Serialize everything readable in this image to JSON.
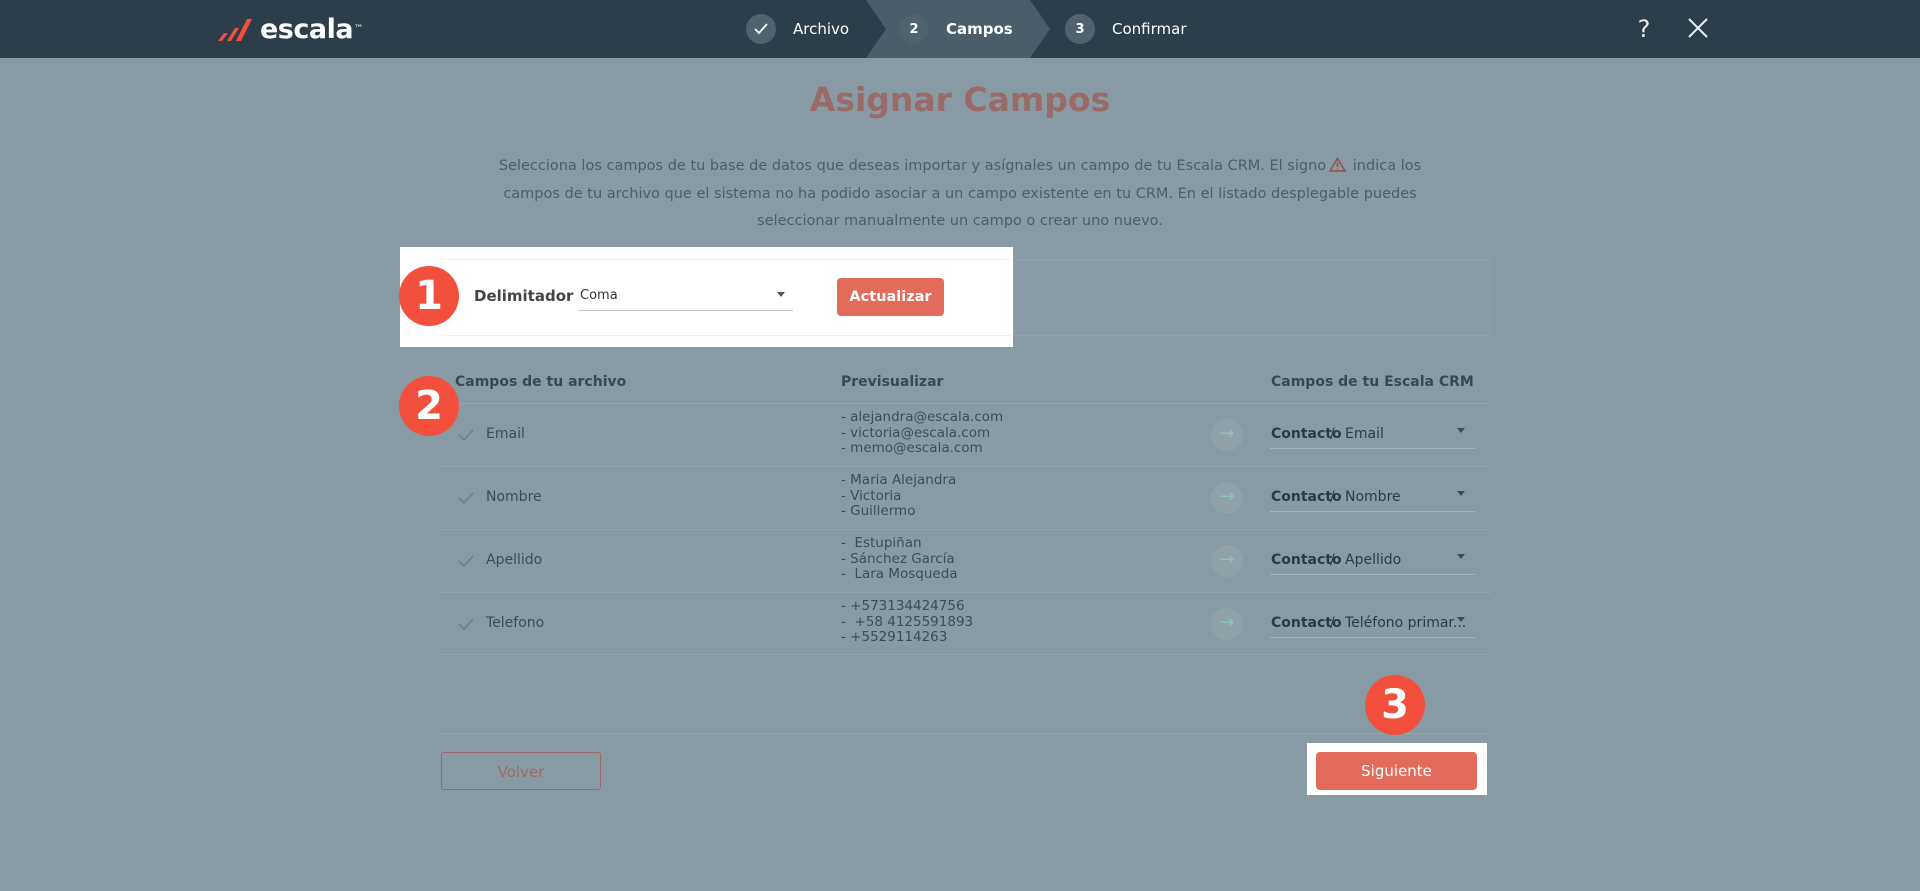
{
  "app": {
    "logo_text": "escala",
    "logo_tm": "™"
  },
  "steps": [
    {
      "number": "",
      "label": "Archivo",
      "state": "done"
    },
    {
      "number": "2",
      "label": "Campos",
      "state": "active"
    },
    {
      "number": "3",
      "label": "Confirmar",
      "state": "pending"
    }
  ],
  "topbar": {
    "help_label": "?",
    "icons": {
      "help": "question-icon",
      "close": "close-icon"
    }
  },
  "page": {
    "title": "Asignar Campos",
    "intro_part1": "Selecciona los campos de tu base de datos que deseas importar y asígnales un campo de tu Escala CRM. El signo",
    "intro_part2": "indica los campos de tu archivo que el sistema no ha podido asociar a un campo existente en tu CRM. En el listado desplegable puedes seleccionar manualmente un campo o crear uno nuevo."
  },
  "delimiter": {
    "label": "Delimitador",
    "value": "Coma",
    "update_label": "Actualizar"
  },
  "markers": [
    "1",
    "2",
    "3"
  ],
  "table": {
    "headers": {
      "file_fields": "Campos de tu archivo",
      "preview": "Previsualizar",
      "crm_fields": "Campos de tu Escala CRM"
    },
    "rows": [
      {
        "field": "Email",
        "preview": [
          "- alejandra@escala.com",
          "- victoria@escala.com",
          "- memo@escala.com"
        ],
        "crm_object": "Contacto",
        "separator": " / ",
        "crm_field": "Email"
      },
      {
        "field": "Nombre",
        "preview": [
          "- Maria Alejandra",
          "- Victoria",
          "- Guillermo"
        ],
        "crm_object": "Contacto",
        "separator": " / ",
        "crm_field": "Nombre"
      },
      {
        "field": "Apellido",
        "preview": [
          "-  Estupiñan",
          "- Sánchez García",
          "-  Lara Mosqueda"
        ],
        "crm_object": "Contacto",
        "separator": " / ",
        "crm_field": "Apellido"
      },
      {
        "field": "Telefono",
        "preview": [
          "- +573134424756",
          "-  +58 4125591893",
          "- +5529114263"
        ],
        "crm_object": "Contacto",
        "separator": " / ",
        "crm_field": "Teléfono primar..."
      }
    ],
    "arrow_glyph": "→"
  },
  "footer": {
    "back_label": "Volver",
    "next_label": "Siguiente"
  },
  "colors": {
    "topbar": "#2c3e4a",
    "overlay": "#889ba4",
    "accent": "#e26b5c",
    "marker": "#f2503d",
    "title_muted": "#9a6a67"
  }
}
